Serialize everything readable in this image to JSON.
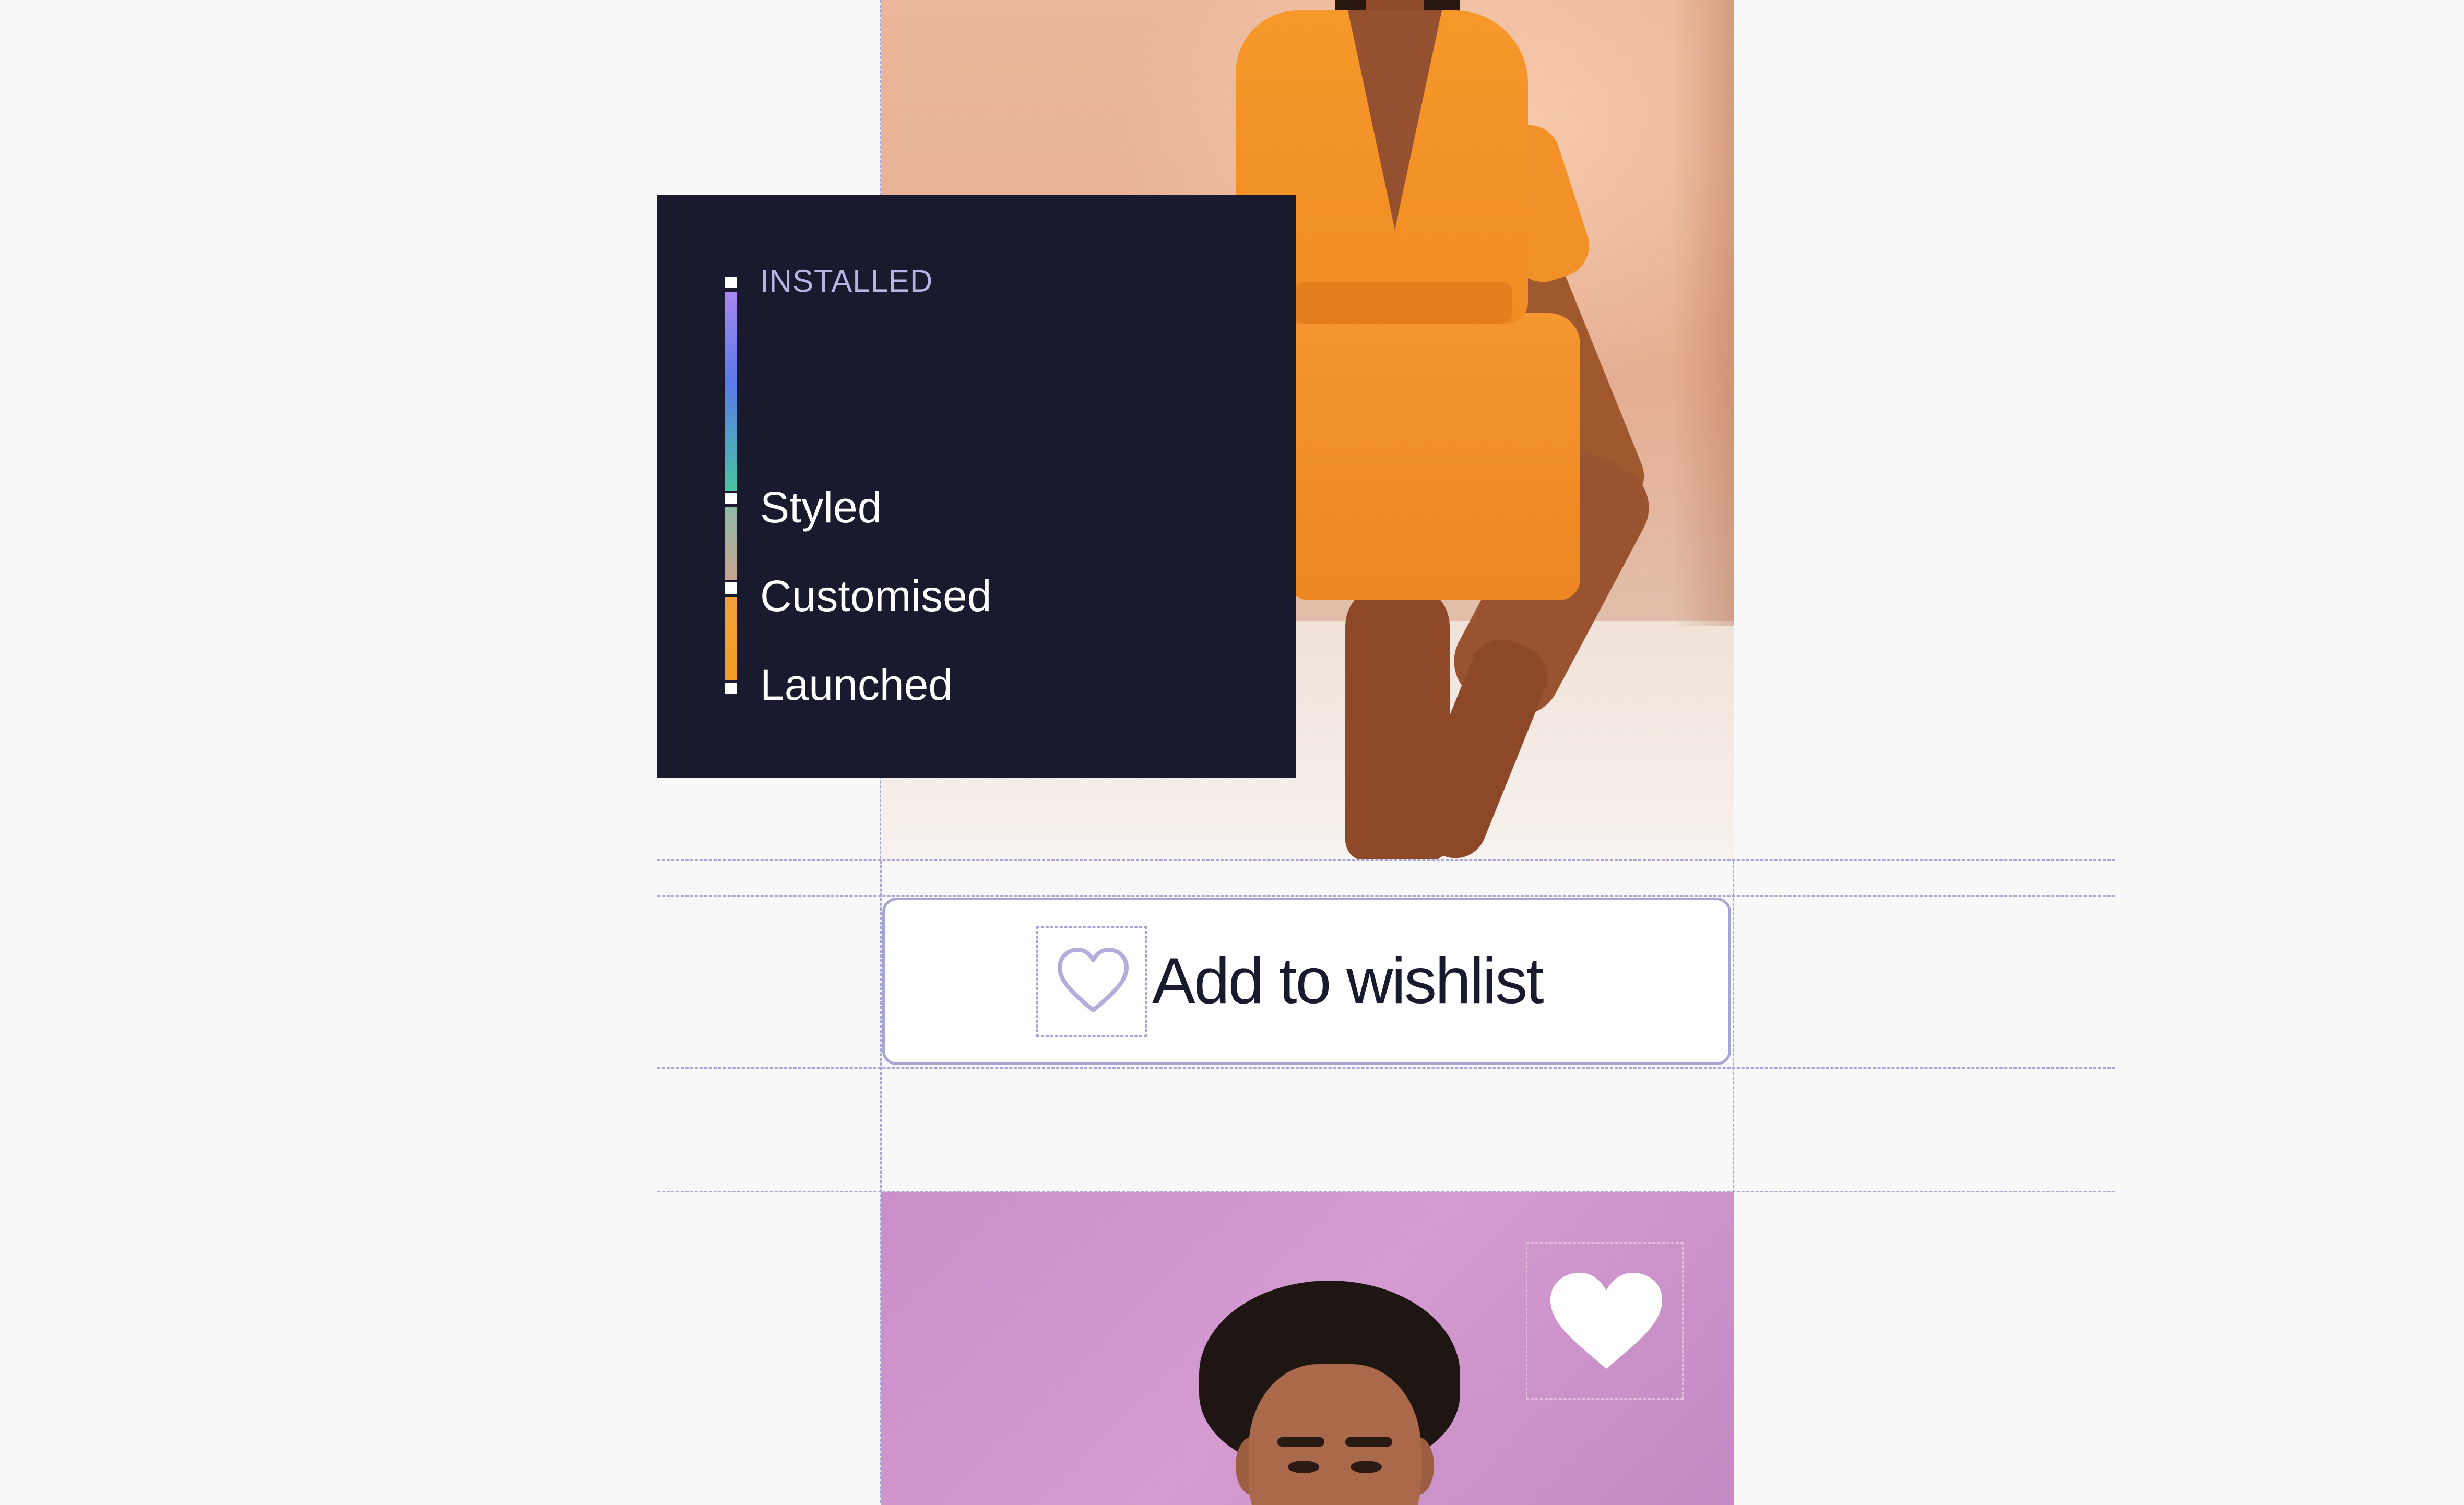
{
  "status_panel": {
    "header": "INSTALLED",
    "steps": [
      "Styled",
      "Customised",
      "Launched"
    ]
  },
  "wishlist": {
    "label": "Add to wishlist",
    "icon": "heart-outline-icon"
  },
  "favorite": {
    "icon": "heart-filled-icon"
  },
  "colors": {
    "panel_background": "#1a1a2e",
    "accent_lavender": "#a9a4d6",
    "text_dark": "#1a1a2e",
    "page_background": "#f8f8f8"
  }
}
